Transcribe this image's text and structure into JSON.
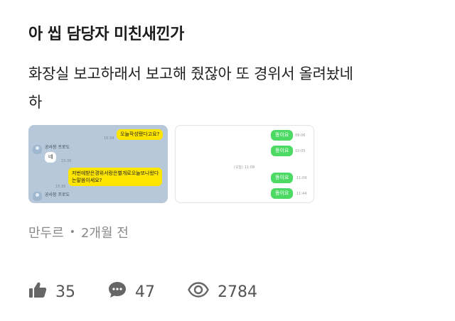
{
  "post": {
    "title": "아 씹 담당자 미친새낀가",
    "body_line1": "화장실 보고하래서 보고해 줬잖아 또 경위서 올려놨네",
    "body_line2": "하",
    "author": "만두르",
    "separator": "•",
    "time_ago": "2개월 전"
  },
  "thumb1": {
    "msg1": "오늘작성됐다고요?",
    "time1": "15:34",
    "sender1": "공사장 프로도",
    "msg2": "네",
    "time2": "15:35",
    "msg3_line1": "저번에받은경위서랑은별개로오늘또나왔다",
    "msg3_line2": "는말씀이세요?",
    "time3": "15:35",
    "sender2": "공사장 프로도"
  },
  "thumb2": {
    "msgs": [
      {
        "text": "똥이요",
        "time": "09:06"
      },
      {
        "text": "똥이요",
        "time": "10:05"
      },
      {
        "text": "똥이요",
        "time": "11:09"
      },
      {
        "text": "똥이요",
        "time": "11:44"
      }
    ],
    "center_label": "(오늘) 11:09"
  },
  "stats": {
    "likes": "35",
    "comments": "47",
    "views": "2784"
  },
  "icons": {
    "like": "thumbs-up-icon",
    "comment": "speech-bubble-icon",
    "view": "eye-icon"
  }
}
